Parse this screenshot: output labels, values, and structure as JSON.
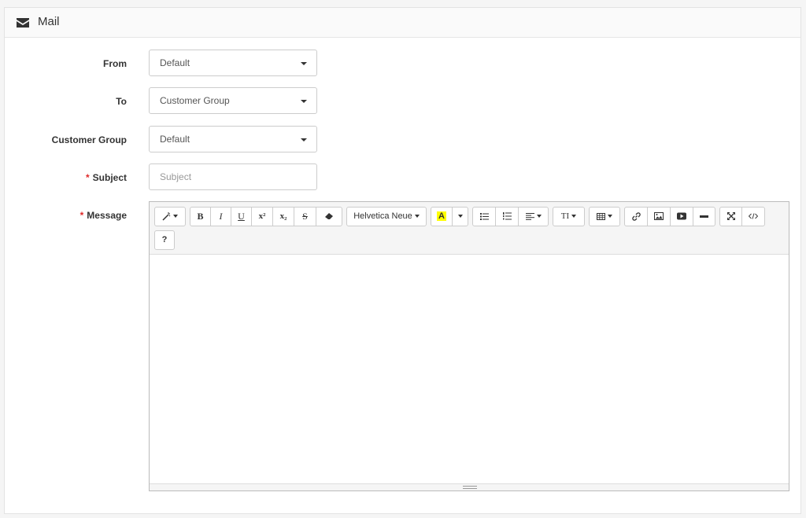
{
  "panel": {
    "title": "Mail",
    "icon": "envelope-icon"
  },
  "form": {
    "from": {
      "label": "From",
      "value": "Default"
    },
    "to": {
      "label": "To",
      "value": "Customer Group"
    },
    "customer_group": {
      "label": "Customer Group",
      "value": "Default"
    },
    "subject": {
      "label": "Subject",
      "required_mark": "*",
      "placeholder": "Subject",
      "value": ""
    },
    "message": {
      "label": "Message",
      "required_mark": "*"
    }
  },
  "editor": {
    "toolbar": {
      "style": "B",
      "italic": "I",
      "underline": "U",
      "superscript": "x²",
      "subscript": "x₂",
      "strikethrough": "S",
      "font_name": "Helvetica Neue",
      "color_label": "A",
      "height": "TI",
      "help": "?"
    },
    "highlight_color": "#ffff00"
  },
  "colors": {
    "required": "#e02a2a",
    "border": "#cccccc"
  }
}
